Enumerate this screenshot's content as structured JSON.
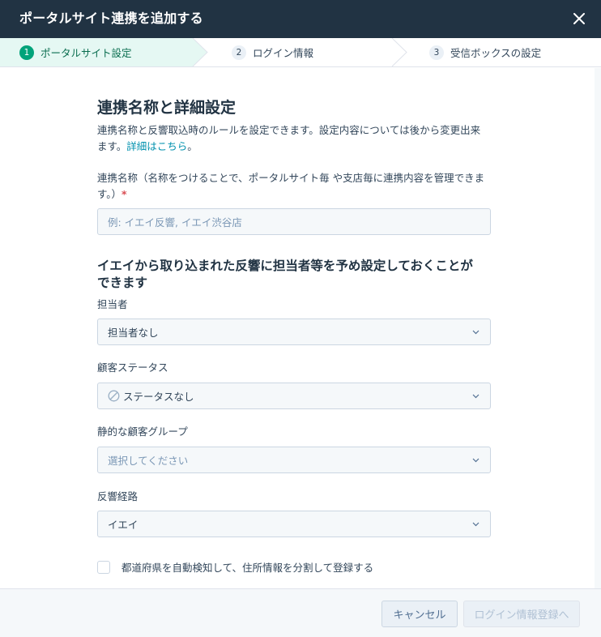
{
  "header": {
    "title": "ポータルサイト連携を追加する"
  },
  "steps": [
    {
      "num": "1",
      "label": "ポータルサイト設定",
      "active": true
    },
    {
      "num": "2",
      "label": "ログイン情報",
      "active": false
    },
    {
      "num": "3",
      "label": "受信ボックスの設定",
      "active": false
    }
  ],
  "section1": {
    "title": "連携名称と詳細設定",
    "desc_line1": "連携名称と反響取込時のルールを設定できます。設定内容については後から変更出来",
    "desc_line2_prefix": "ます。",
    "desc_link": "詳細はこちら",
    "desc_line2_suffix": "。"
  },
  "name_field": {
    "label_line1": "連携名称（名称をつけることで、ポータルサイト毎 や支店毎に連携内容を管理できま",
    "label_line2": "す。）",
    "required_mark": "*",
    "placeholder": "例: イエイ反響, イエイ渋谷店",
    "value": ""
  },
  "section2": {
    "title_line1": "イエイから取り込まれた反響に担当者等を予め設定しておくことが",
    "title_line2": "できます"
  },
  "owner": {
    "label": "担当者",
    "value": "担当者なし"
  },
  "status": {
    "label": "顧客ステータス",
    "value": "ステータスなし"
  },
  "group": {
    "label": "静的な顧客グループ",
    "placeholder": "選択してください"
  },
  "source": {
    "label": "反響経路",
    "value": "イエイ"
  },
  "auto_detect": {
    "label": "都道府県を自動検知して、住所情報を分割して登録する",
    "checked": false
  },
  "footer": {
    "cancel": "キャンセル",
    "next": "ログイン情報登録へ"
  },
  "colors": {
    "header_bg": "#213343",
    "accent": "#00a37a",
    "active_step_bg": "#e5f8f3",
    "link": "#0091ae",
    "required": "#d94c53"
  },
  "icons": {
    "close": "close-icon",
    "chevron": "chevron-down-icon",
    "no_status": "no-status-icon"
  }
}
